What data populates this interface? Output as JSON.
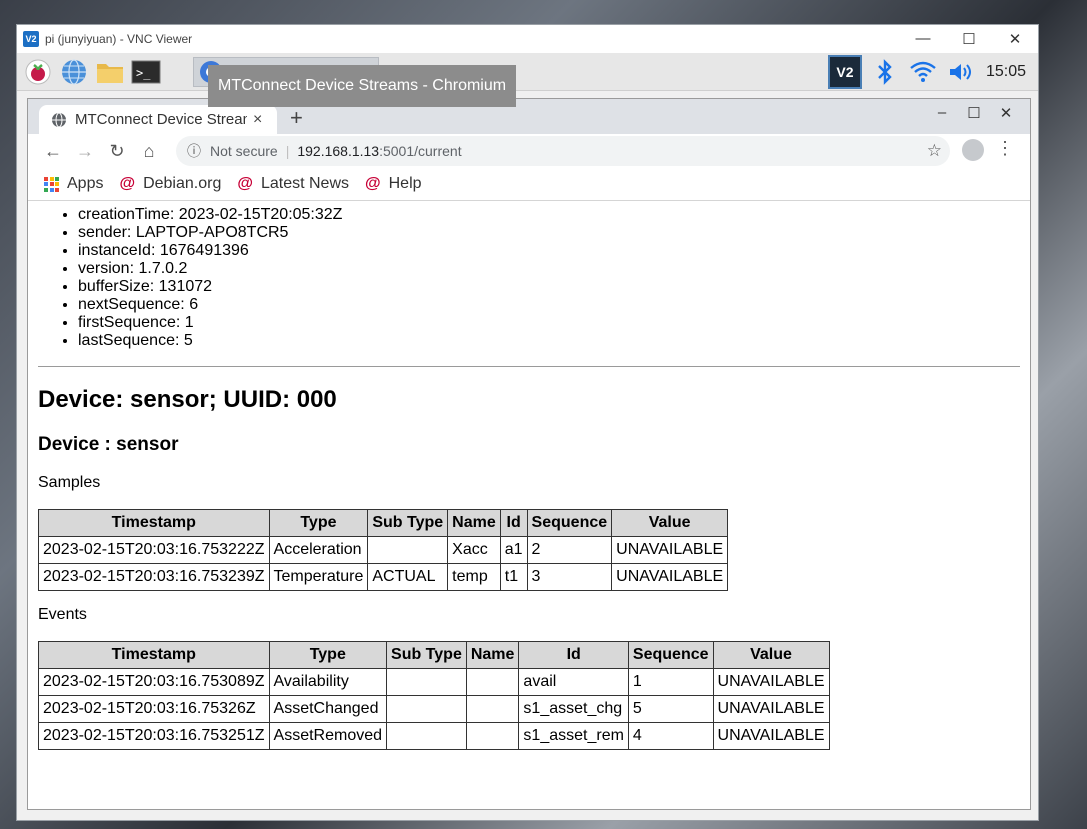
{
  "vnc": {
    "logo": "V2",
    "title": "pi (junyiyuan) - VNC Viewer",
    "controls": [
      "—",
      "☐",
      "✕"
    ]
  },
  "panel": {
    "tooltip": "MTConnect Device Streams - Chromium",
    "clock": "15:05",
    "vnc_tray": "V2",
    "terminal_glyph": ">_",
    "icons": [
      "raspberry-icon",
      "globe-icon",
      "folder-icon",
      "terminal-icon",
      "chromium-icon",
      "vnc-tray-icon",
      "bluetooth-icon",
      "wifi-icon",
      "volume-icon"
    ]
  },
  "browser": {
    "tab_title": "MTConnect Device Streams",
    "tab_close": "×",
    "new_tab": "+",
    "window_controls": [
      "–",
      "☐",
      "✕"
    ],
    "nav": {
      "back": "←",
      "forward": "→",
      "reload": "↻",
      "home": "⌂"
    },
    "omnibox": {
      "info": "ⓘ",
      "security_label": "Not secure",
      "separator": "|",
      "host": "192.168.1.13",
      "path": ":5001/current",
      "star": "☆"
    },
    "menu": "⋮",
    "bookmarks": [
      {
        "label": "Apps"
      },
      {
        "label": "Debian.org"
      },
      {
        "label": "Latest News"
      },
      {
        "label": "Help"
      }
    ],
    "debian_glyph": "@",
    "apps_colors": [
      "#ea4335",
      "#fbbc05",
      "#34a853",
      "#4285f4",
      "#ea4335",
      "#fbbc05",
      "#34a853",
      "#4285f4",
      "#ea4335"
    ]
  },
  "page": {
    "header_info": [
      "creationTime: 2023-02-15T20:05:32Z",
      "sender: LAPTOP-APO8TCR5",
      "instanceId: 1676491396",
      "version: 1.7.0.2",
      "bufferSize: 131072",
      "nextSequence: 6",
      "firstSequence: 1",
      "lastSequence: 5"
    ],
    "device_heading": "Device: sensor; UUID: 000",
    "component_heading": "Device : sensor",
    "samples_label": "Samples",
    "samples_columns": [
      "Timestamp",
      "Type",
      "Sub Type",
      "Name",
      "Id",
      "Sequence",
      "Value"
    ],
    "samples_rows": [
      [
        "2023-02-15T20:03:16.753222Z",
        "Acceleration",
        "",
        "Xacc",
        "a1",
        "2",
        "UNAVAILABLE"
      ],
      [
        "2023-02-15T20:03:16.753239Z",
        "Temperature",
        "ACTUAL",
        "temp",
        "t1",
        "3",
        "UNAVAILABLE"
      ]
    ],
    "events_label": "Events",
    "events_columns": [
      "Timestamp",
      "Type",
      "Sub Type",
      "Name",
      "Id",
      "Sequence",
      "Value"
    ],
    "events_rows": [
      [
        "2023-02-15T20:03:16.753089Z",
        "Availability",
        "",
        "",
        "avail",
        "1",
        "UNAVAILABLE"
      ],
      [
        "2023-02-15T20:03:16.75326Z",
        "AssetChanged",
        "",
        "",
        "s1_asset_chg",
        "5",
        "UNAVAILABLE"
      ],
      [
        "2023-02-15T20:03:16.753251Z",
        "AssetRemoved",
        "",
        "",
        "s1_asset_rem",
        "4",
        "UNAVAILABLE"
      ]
    ]
  }
}
